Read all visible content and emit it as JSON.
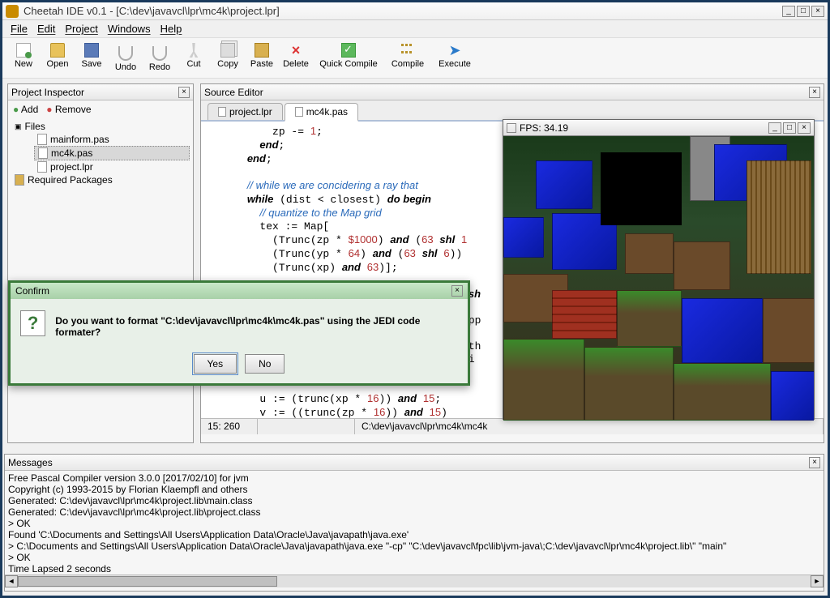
{
  "window": {
    "title": "Cheetah IDE v0.1 - [C:\\dev\\javavcl\\lpr\\mc4k\\project.lpr]"
  },
  "menu": [
    "File",
    "Edit",
    "Project",
    "Windows",
    "Help"
  ],
  "toolbar": {
    "new": "New",
    "open": "Open",
    "save": "Save",
    "undo": "Undo",
    "redo": "Redo",
    "cut": "Cut",
    "copy": "Copy",
    "paste": "Paste",
    "delete": "Delete",
    "quickcompile": "Quick Compile",
    "compile": "Compile",
    "execute": "Execute"
  },
  "inspector": {
    "title": "Project Inspector",
    "add": "Add",
    "remove": "Remove",
    "files_label": "Files",
    "files": [
      "mainform.pas",
      "mc4k.pas",
      "project.lpr"
    ],
    "selected": "mc4k.pas",
    "required": "Required Packages"
  },
  "editor": {
    "title": "Source Editor",
    "tabs": [
      "project.lpr",
      "mc4k.pas"
    ],
    "active_tab": "mc4k.pas",
    "status_pos": "15: 260",
    "status_path": "C:\\dev\\javavcl\\lpr\\mc4k\\mc4k"
  },
  "game": {
    "title": "FPS: 34.19"
  },
  "dialog": {
    "title": "Confirm",
    "message": "Do you want to format \"C:\\dev\\javavcl\\lpr\\mc4k\\mc4k.pas\" using the JEDI code formater?",
    "yes": "Yes",
    "no": "No"
  },
  "messages": {
    "title": "Messages",
    "lines": [
      "Free Pascal Compiler version 3.0.0 [2017/02/10] for jvm",
      "Copyright (c) 1993-2015 by Florian Klaempfl and others",
      "Generated: C:\\dev\\javavcl\\lpr\\mc4k\\project.lib\\main.class",
      "Generated: C:\\dev\\javavcl\\lpr\\mc4k\\project.lib\\project.class",
      "> OK",
      "Found 'C:\\Documents and Settings\\All Users\\Application Data\\Oracle\\Java\\javapath\\java.exe'",
      "> C:\\Documents and Settings\\All Users\\Application Data\\Oracle\\Java\\javapath\\java.exe \"-cp\" \"C:\\dev\\javavcl\\fpc\\lib\\jvm-java\\;C:\\dev\\javavcl\\lpr\\mc4k\\project.lib\\\" \"main\"",
      "> OK",
      "Time Lapsed 2 seconds"
    ]
  }
}
